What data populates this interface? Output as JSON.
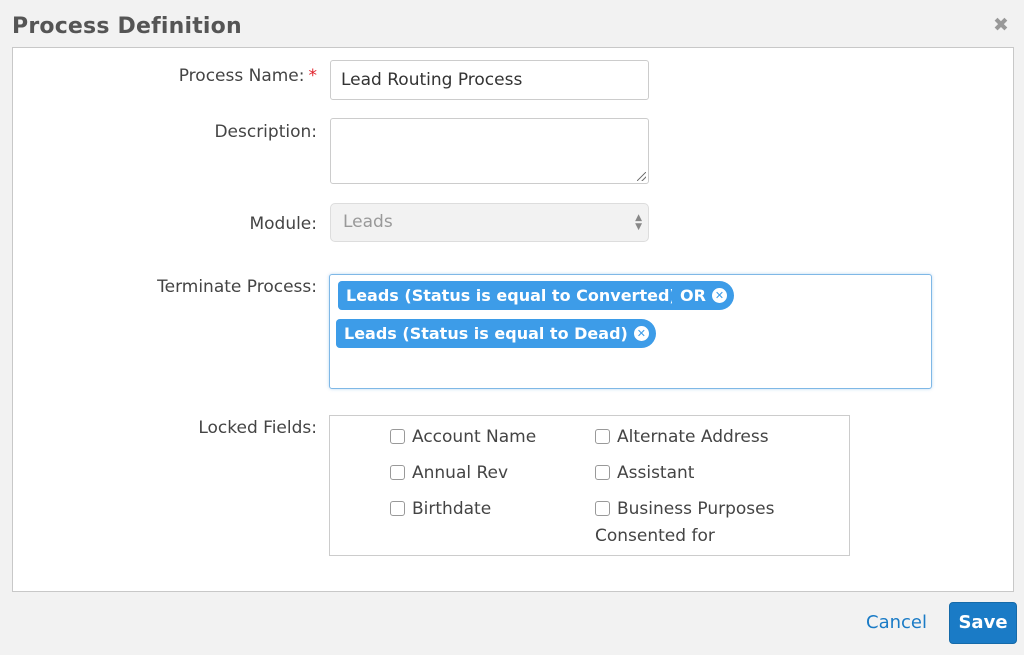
{
  "dialog": {
    "title": "Process Definition",
    "close_icon": "close-icon"
  },
  "form": {
    "process_name": {
      "label": "Process Name:",
      "required_mark": "*",
      "value": "Lead Routing Process"
    },
    "description": {
      "label": "Description:",
      "value": ""
    },
    "module": {
      "label": "Module:",
      "value": "Leads"
    },
    "terminate_process": {
      "label": "Terminate Process:",
      "tokens": [
        "Leads (Status is equal to Converted)",
        "OR",
        "Leads (Status is equal to Dead)"
      ]
    },
    "locked_fields": {
      "label": "Locked Fields:",
      "options": [
        {
          "label": "Account Name",
          "checked": false
        },
        {
          "label": "Alternate Address",
          "checked": false
        },
        {
          "label": "Annual Rev",
          "checked": false
        },
        {
          "label": "Assistant",
          "checked": false
        },
        {
          "label": "Birthdate",
          "checked": false
        },
        {
          "label": "Business Purposes",
          "continuation": "Consented for",
          "checked": false
        }
      ]
    }
  },
  "footer": {
    "cancel_label": "Cancel",
    "save_label": "Save"
  },
  "colors": {
    "accent": "#1a7bc6",
    "pill": "#3d9ce8",
    "required": "#e0202a"
  }
}
